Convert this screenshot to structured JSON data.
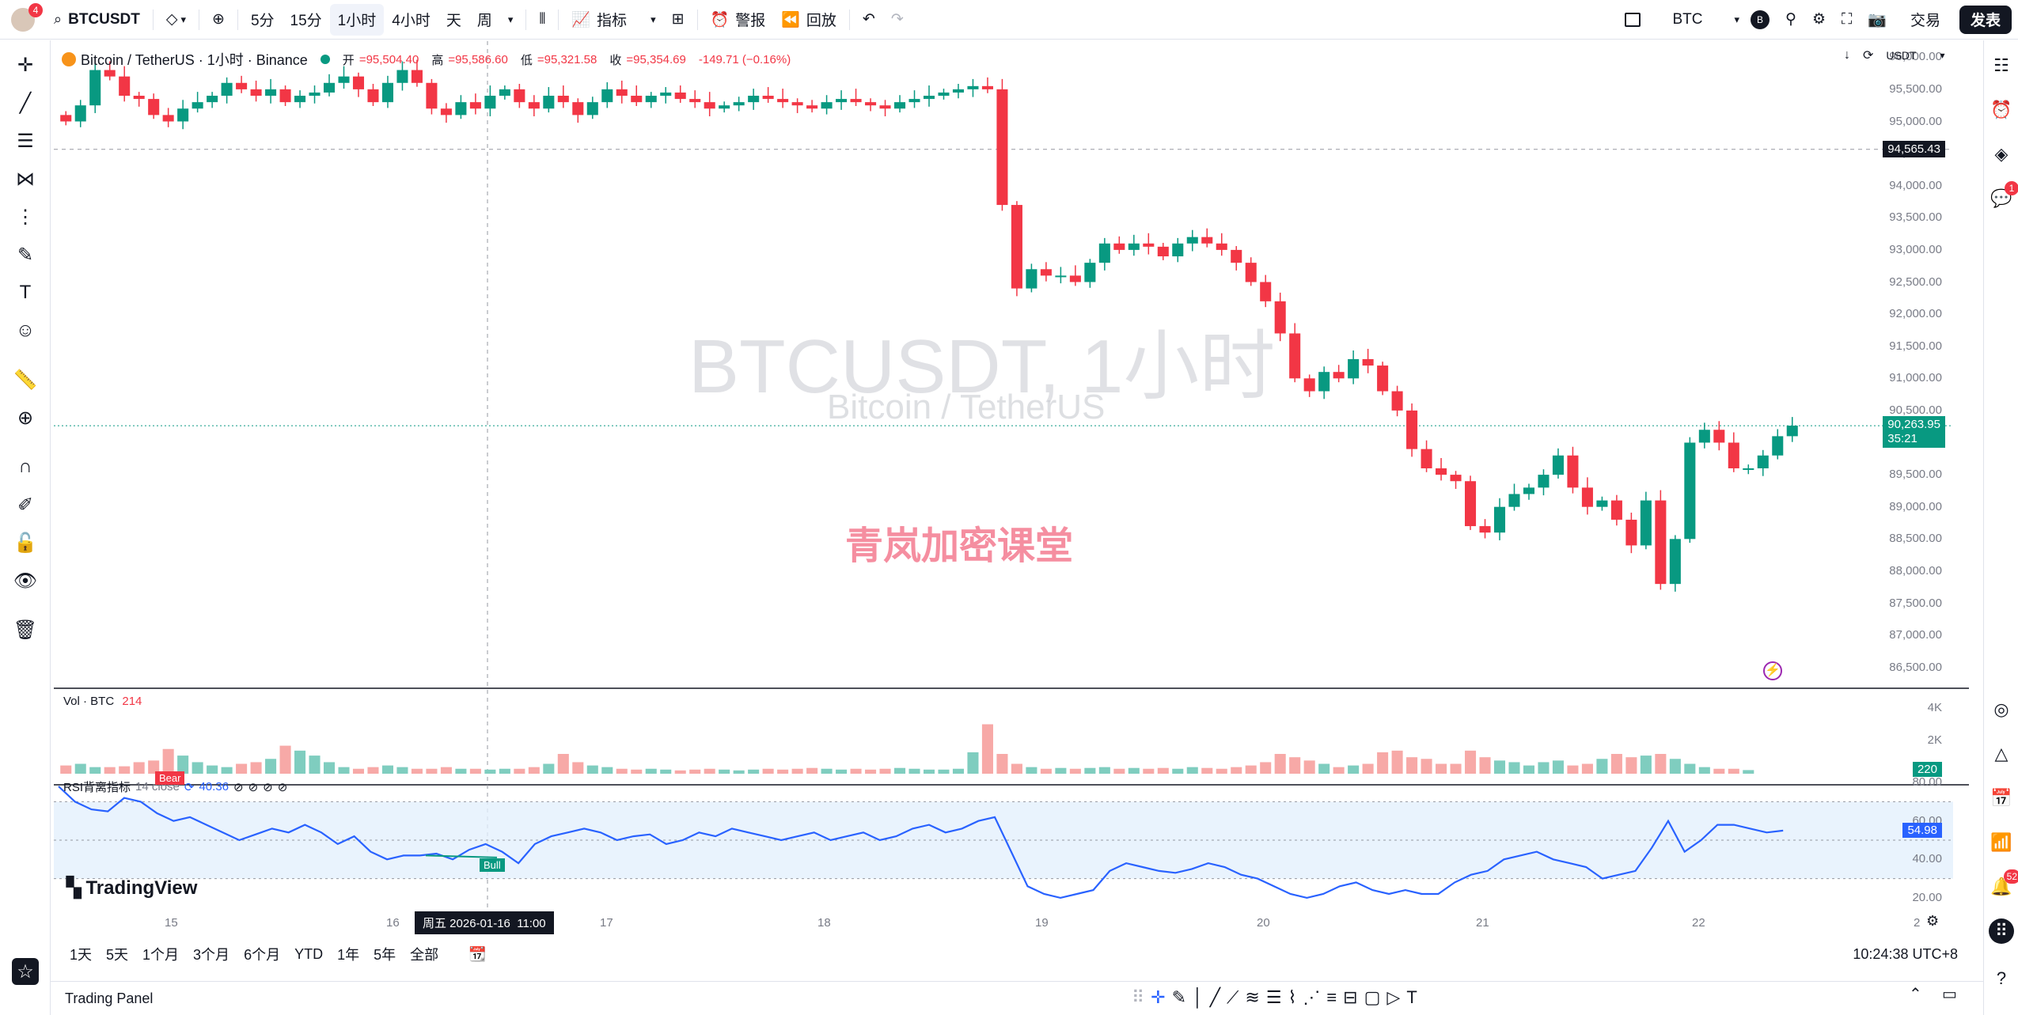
{
  "topbar": {
    "avatar_badge": "4",
    "symbol": "BTCUSDT",
    "intervals": [
      "5分",
      "15分",
      "1小时",
      "4小时",
      "天",
      "周"
    ],
    "active_interval": "1小时",
    "indicators_label": "指标",
    "alert_label": "警报",
    "replay_label": "回放",
    "currency": "BTC",
    "currency_badge": "B",
    "trade_label": "交易",
    "publish_label": "发表"
  },
  "legend": {
    "title": "Bitcoin / TetherUS · 1小时 · Binance",
    "open_label": "开",
    "open": "=95,504.40",
    "high_label": "高",
    "high": "=95,586.60",
    "low_label": "低",
    "low": "=95,321.58",
    "close_label": "收",
    "close": "=95,354.69",
    "change": "-149.71 (−0.16%)"
  },
  "watermark": {
    "symbol": "BTCUSDT, 1小时",
    "description": "Bitcoin / TetherUS",
    "overlay_text": "青岚加密课堂"
  },
  "price_scale": {
    "currency": "USDT",
    "ticks": [
      "96,000.00",
      "95,500.00",
      "95,000.00",
      "94,500.00",
      "94,000.00",
      "93,500.00",
      "93,000.00",
      "92,500.00",
      "92,000.00",
      "91,500.00",
      "91,000.00",
      "90,500.00",
      "89,500.00",
      "89,000.00",
      "88,500.00",
      "88,000.00",
      "87,500.00",
      "87,000.00",
      "86,500.00"
    ],
    "crosshair_price": "94,565.43",
    "last_price": "90,263.95",
    "countdown": "35:21"
  },
  "volume": {
    "label": "Vol · BTC",
    "value": "214",
    "ticks": [
      "4K",
      "2K"
    ],
    "last": "220"
  },
  "rsi": {
    "label": "RSI背离指标",
    "params": "14 close",
    "value": "40.36",
    "ticks": [
      "80.00",
      "60.00",
      "40.00",
      "20.00"
    ],
    "last": "54.98",
    "bear_tag": "Bear",
    "bull_tag": "Bull"
  },
  "time_axis": {
    "labels": [
      "15",
      "16",
      "17",
      "18",
      "19",
      "20",
      "21",
      "22",
      "2"
    ],
    "crosshair_time": "周五 2026-01-16  11:00"
  },
  "bottom_bar": {
    "ranges": [
      "1天",
      "5天",
      "1个月",
      "3个月",
      "6个月",
      "YTD",
      "1年",
      "5年",
      "全部"
    ],
    "clock": "10:24:38 UTC+8"
  },
  "trading_panel": {
    "label": "Trading Panel"
  },
  "right_toolbar": {
    "chat_badge": "1",
    "notif_badge": "52"
  },
  "brand": {
    "logo_text": "TradingView"
  },
  "colors": {
    "up": "#089981",
    "down": "#f23645",
    "rsi_line": "#2962ff",
    "rsi_band": "#e3f0fd",
    "accent": "#2962ff"
  },
  "chart_data": {
    "type": "candlestick",
    "interval": "1小时",
    "symbol": "BTCUSDT",
    "ylim": [
      86250,
      96250
    ],
    "close_series": [
      95000,
      95250,
      95800,
      95700,
      95400,
      95350,
      95100,
      95000,
      95200,
      95300,
      95400,
      95600,
      95500,
      95400,
      95500,
      95300,
      95400,
      95450,
      95600,
      95700,
      95500,
      95300,
      95600,
      95800,
      95600,
      95200,
      95100,
      95300,
      95200,
      95400,
      95500,
      95300,
      95200,
      95400,
      95300,
      95100,
      95300,
      95500,
      95400,
      95300,
      95400,
      95450,
      95350,
      95300,
      95200,
      95250,
      95300,
      95400,
      95350,
      95300,
      95250,
      95200,
      95300,
      95350,
      95300,
      95250,
      95200,
      95300,
      95350,
      95400,
      95450,
      95500,
      95550,
      95500,
      93700,
      92400,
      92700,
      92600,
      92600,
      92500,
      92800,
      93100,
      93000,
      93100,
      93050,
      92900,
      93100,
      93200,
      93100,
      93000,
      92800,
      92500,
      92200,
      91700,
      91000,
      90800,
      91100,
      91000,
      91300,
      91200,
      90800,
      90500,
      89900,
      89600,
      89500,
      89400,
      88700,
      88600,
      89000,
      89200,
      89300,
      89500,
      89800,
      89300,
      89000,
      89100,
      88800,
      88400,
      89100,
      87800,
      88500,
      90000,
      90200,
      90000,
      89600,
      89600,
      89800,
      90100,
      90264
    ],
    "volume_series": [
      500,
      600,
      400,
      400,
      450,
      700,
      800,
      1500,
      1100,
      700,
      500,
      400,
      600,
      700,
      900,
      1700,
      1400,
      1100,
      700,
      400,
      300,
      400,
      500,
      400,
      300,
      300,
      400,
      300,
      300,
      250,
      300,
      300,
      400,
      600,
      1200,
      700,
      500,
      400,
      300,
      250,
      300,
      250,
      200,
      250,
      300,
      250,
      200,
      250,
      300,
      250,
      300,
      350,
      300,
      250,
      300,
      250,
      300,
      350,
      300,
      250,
      250,
      300,
      1300,
      3000,
      1200,
      600,
      400,
      300,
      350,
      300,
      350,
      400,
      300,
      350,
      300,
      350,
      300,
      400,
      350,
      300,
      400,
      500,
      700,
      1200,
      1000,
      800,
      600,
      400,
      500,
      600,
      1300,
      1400,
      1000,
      900,
      600,
      600,
      1400,
      1000,
      800,
      700,
      500,
      700,
      800,
      500,
      600,
      900,
      1200,
      1000,
      1100,
      1200,
      900,
      600,
      400,
      300,
      300,
      220
    ],
    "rsi_series": [
      78,
      70,
      66,
      65,
      72,
      70,
      64,
      60,
      62,
      58,
      54,
      50,
      53,
      56,
      54,
      58,
      54,
      48,
      52,
      44,
      40,
      42,
      42,
      43,
      40,
      45,
      48,
      44,
      38,
      48,
      52,
      54,
      56,
      54,
      50,
      52,
      53,
      48,
      50,
      54,
      52,
      56,
      54,
      52,
      50,
      52,
      54,
      50,
      52,
      54,
      50,
      52,
      56,
      58,
      54,
      56,
      60,
      62,
      44,
      26,
      22,
      20,
      22,
      24,
      34,
      38,
      36,
      34,
      33,
      35,
      38,
      36,
      32,
      30,
      26,
      22,
      20,
      22,
      26,
      28,
      24,
      22,
      24,
      22,
      22,
      28,
      32,
      34,
      40,
      42,
      44,
      40,
      38,
      36,
      30,
      32,
      34,
      46,
      60,
      44,
      50,
      58,
      58,
      56,
      54,
      55
    ],
    "rsi_ylim": [
      15,
      85
    ],
    "rsi_band": [
      30,
      70
    ],
    "volume_ylim": [
      0,
      4800
    ],
    "x_tick_labels": [
      "15",
      "16",
      "17",
      "18",
      "19",
      "20",
      "21",
      "22",
      "2"
    ],
    "horizontal_lines": {
      "crosshair_price": 94565.43,
      "last_price": 90263.95
    }
  }
}
